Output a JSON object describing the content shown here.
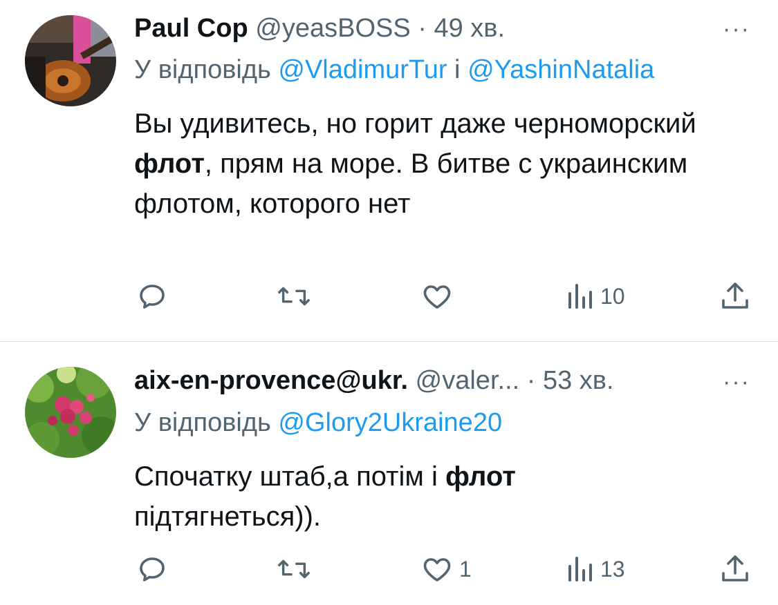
{
  "tweets": [
    {
      "name": "Paul Cop",
      "handle": "@yeasBOSS",
      "dot": "·",
      "time": "49 хв.",
      "reply_prefix": "У відповідь",
      "mentions": [
        "@VladimurTur",
        "@YashinNatalia"
      ],
      "mention_joiner": "і",
      "body_before": "Вы удивитесь, но горит даже черноморский ",
      "body_bold": "флот",
      "body_after": ", прям на море. В битве с украинским флотом, которого нет",
      "more_label": "···",
      "actions": {
        "reply_count": "",
        "retweet_count": "",
        "like_count": "",
        "views_count": "10"
      }
    },
    {
      "name": "aix-en-provence@ukr.",
      "handle": "@valer...",
      "dot": "·",
      "time": "53 хв.",
      "reply_prefix": "У відповідь",
      "mentions": [
        "@Glory2Ukraine20"
      ],
      "body_before": "Спочатку штаб,а потім і ",
      "body_bold": "флот",
      "body_after": " підтягнеться)).",
      "more_label": "···",
      "actions": {
        "reply_count": "",
        "retweet_count": "",
        "like_count": "1",
        "views_count": "13"
      }
    }
  ],
  "colors": {
    "text": "#0f1419",
    "secondary": "#536471",
    "link": "#1d9bf0",
    "divider": "#d9dee2"
  },
  "icons": [
    "reply-icon",
    "retweet-icon",
    "like-icon",
    "views-icon",
    "share-icon",
    "more-icon"
  ]
}
